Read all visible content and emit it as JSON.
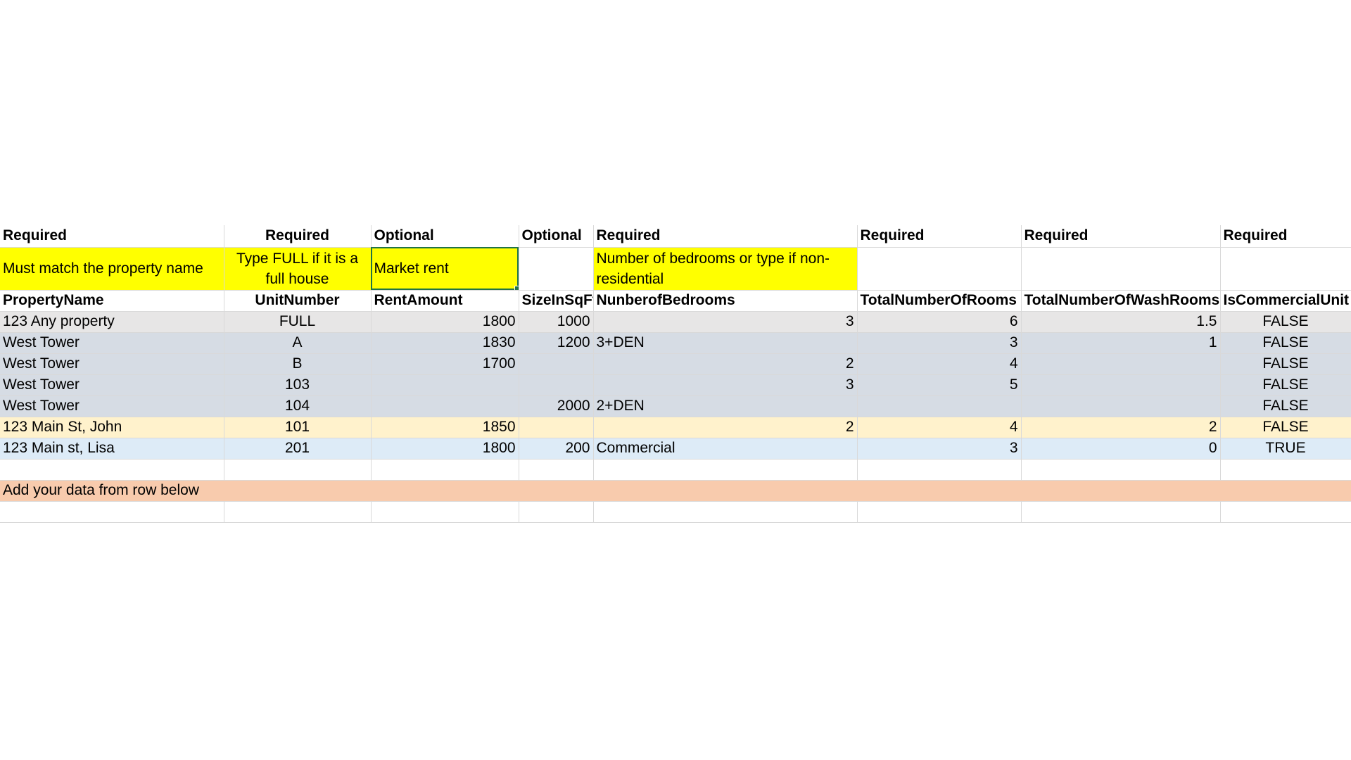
{
  "requirement_row": [
    "Required",
    "Required",
    "Optional",
    "Optional",
    "Required",
    "Required",
    "Required",
    "Required"
  ],
  "hint_row": [
    "Must match the property name",
    "Type FULL if it is a full house",
    "Market rent",
    "",
    "Number of bedrooms or type if non-residential",
    "",
    "",
    ""
  ],
  "header_row": [
    "PropertyName",
    "UnitNumber",
    "RentAmount",
    "SizeInSqFt",
    "NunberofBedrooms",
    "TotalNumberOfRooms",
    "TotalNumberOfWashRooms",
    "IsCommercialUnit"
  ],
  "rows": [
    [
      "123 Any property",
      "FULL",
      "1800",
      "1000",
      "3",
      "6",
      "1.5",
      "FALSE"
    ],
    [
      "West Tower",
      "A",
      "1830",
      "1200",
      "3+DEN",
      "3",
      "1",
      "FALSE"
    ],
    [
      "West Tower",
      "B",
      "1700",
      "",
      "2",
      "4",
      "",
      "FALSE"
    ],
    [
      "West Tower",
      "103",
      "",
      "",
      "3",
      "5",
      "",
      "FALSE"
    ],
    [
      "West Tower",
      "104",
      "",
      "2000",
      "2+DEN",
      "",
      "",
      "FALSE"
    ],
    [
      "123 Main St, John",
      "101",
      "1850",
      "",
      "2",
      "4",
      "2",
      "FALSE"
    ],
    [
      "123 Main st, Lisa",
      "201",
      "1800",
      "200",
      "Commercial",
      "3",
      "0",
      "TRUE"
    ]
  ],
  "instruction_text": "Add your data from  row below",
  "colors": {
    "hint_highlight": "#ffff00",
    "row_gray": "#e7e6e6",
    "row_blue_gray": "#d6dce4",
    "row_cream": "#fff2cc",
    "row_light_blue": "#ddebf7",
    "instruction_band": "#f8cbad",
    "selection_border": "#217346"
  }
}
